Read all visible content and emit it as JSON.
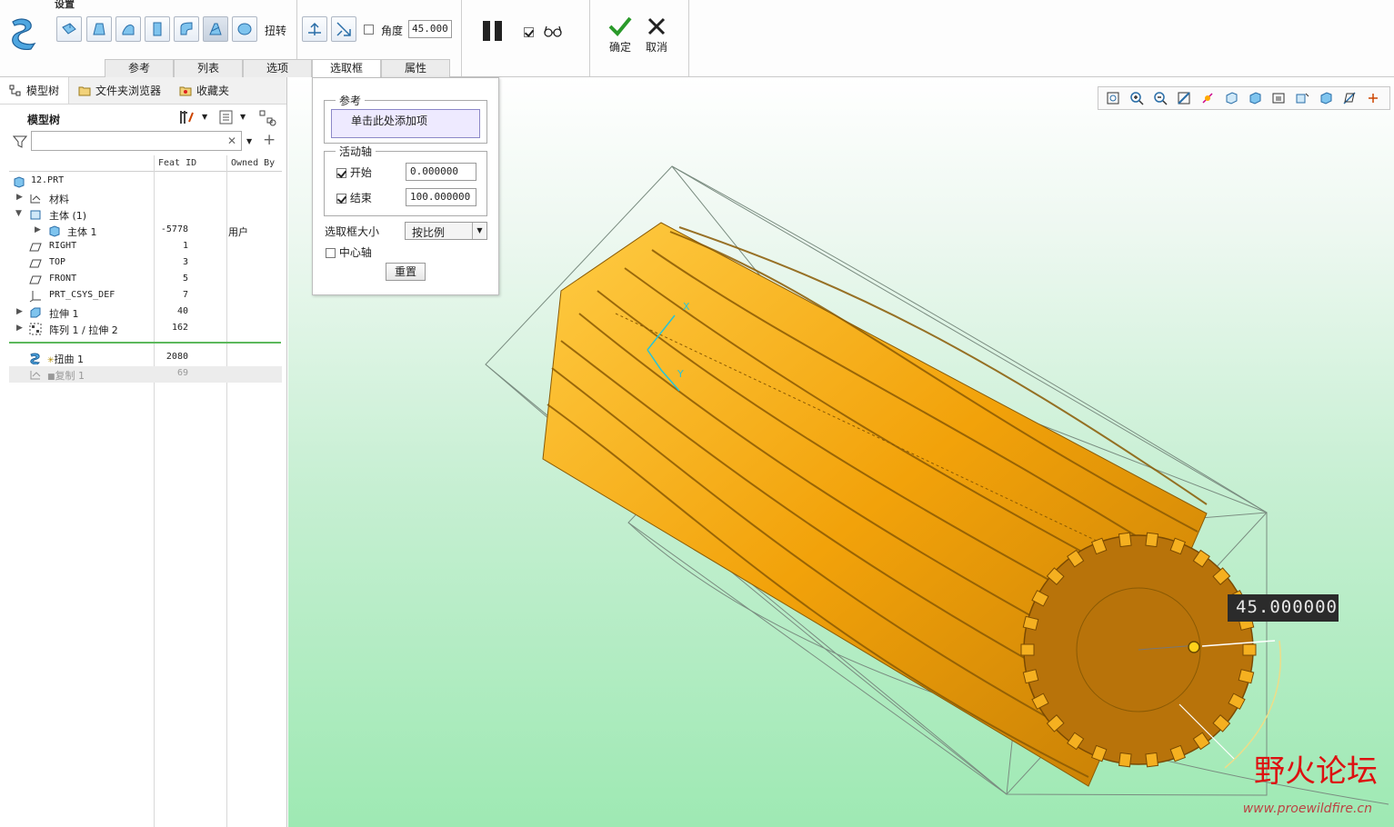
{
  "ribbon": {
    "group_title": "设置",
    "twist_label": "扭转",
    "angle_label": "角度",
    "angle_value": "45.000",
    "ok_label": "确定",
    "cancel_label": "取消",
    "tabs": [
      "参考",
      "列表",
      "选项",
      "选取框",
      "属性"
    ],
    "active_tab": "选取框"
  },
  "left_panel": {
    "tabs": [
      "模型树",
      "文件夹浏览器",
      "收藏夹"
    ],
    "tree_title": "模型树",
    "filter_placeholder": "",
    "columns": [
      "Feat ID",
      "Owned By"
    ],
    "rows": [
      {
        "name": "12.PRT",
        "fid": "",
        "own": ""
      },
      {
        "name": "材料",
        "fid": "",
        "own": ""
      },
      {
        "name": "主体 (1)",
        "fid": "",
        "own": ""
      },
      {
        "name": "主体 1",
        "fid": "-5778",
        "own": "用户"
      },
      {
        "name": "RIGHT",
        "fid": "1",
        "own": ""
      },
      {
        "name": "TOP",
        "fid": "3",
        "own": ""
      },
      {
        "name": "FRONT",
        "fid": "5",
        "own": ""
      },
      {
        "name": "PRT_CSYS_DEF",
        "fid": "7",
        "own": ""
      },
      {
        "name": "拉伸 1",
        "fid": "40",
        "own": ""
      },
      {
        "name": "阵列 1 / 拉伸 2",
        "fid": "162",
        "own": ""
      },
      {
        "name": "扭曲 1",
        "fid": "2080",
        "own": ""
      },
      {
        "name": "复制 1",
        "fid": "69",
        "own": ""
      }
    ]
  },
  "popup": {
    "ref_legend": "参考",
    "ref_placeholder": "单击此处添加项",
    "axis_legend": "活动轴",
    "start_label": "开始",
    "start_value": "0.000000",
    "end_label": "结束",
    "end_value": "100.000000",
    "size_label": "选取框大小",
    "size_value": "按比例",
    "center_axis_label": "中心轴",
    "reset_label": "重置"
  },
  "viewport": {
    "dimension": "45.000000",
    "axis_x": "X",
    "axis_y": "Y",
    "watermark_main": "野火论坛",
    "watermark_url": "www.proewildfire.cn",
    "part_color": "#f5a80f",
    "part_dark": "#b06e08"
  }
}
